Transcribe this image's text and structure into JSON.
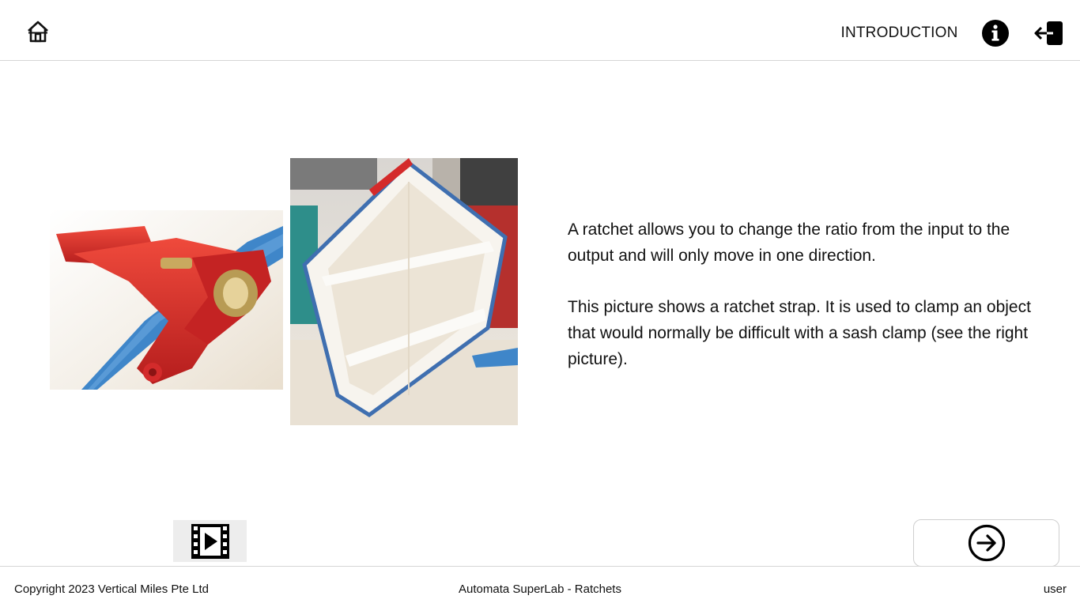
{
  "header": {
    "home_icon": "home-icon",
    "section_title": "INTRODUCTION",
    "info_icon": "info-icon",
    "exit_icon": "exit-icon"
  },
  "main": {
    "images": [
      {
        "name": "ratchet-strap-photo",
        "subject": "red ratchet mechanism on blue strap"
      },
      {
        "name": "shelf-clamped-photo",
        "subject": "house-shaped wooden shelf clamped with blue ratchet strap"
      }
    ],
    "paragraphs": [
      "A ratchet allows you to change the ratio from the input to the output and will only move in one direction.",
      "This picture shows a ratchet strap. It is used to clamp an object that would normally be difficult with a sash clamp (see the right picture)."
    ],
    "video_icon": "film-play-icon",
    "next_icon": "arrow-right-circle-icon"
  },
  "footer": {
    "copyright": "Copyright 2023 Vertical Miles Pte Ltd",
    "app_title": "Automata SuperLab - Ratchets",
    "user": "user"
  },
  "colors": {
    "strap_blue": "#3f86c9",
    "ratchet_red": "#d42a2a",
    "divider": "#d6d6d6"
  }
}
